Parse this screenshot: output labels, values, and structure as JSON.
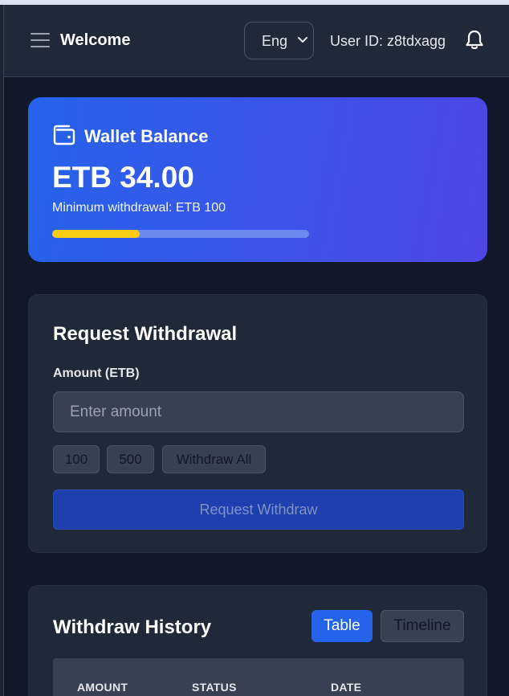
{
  "header": {
    "menu_icon": "hamburger-menu-icon",
    "title": "Welcome",
    "language_selected": "Eng",
    "user_id": "User ID: z8tdxagg",
    "notification_icon": "bell-icon"
  },
  "wallet": {
    "icon": "wallet-icon",
    "title": "Wallet Balance",
    "balance": "ETB 34.00",
    "minimum_text": "Minimum withdrawal: ETB 100",
    "progress_fraction": 0.34,
    "colors": {
      "gradient_start": "#2563eb",
      "gradient_end": "#4f46e5",
      "progress": "#facc15"
    }
  },
  "withdraw_form": {
    "title": "Request Withdrawal",
    "amount_label": "Amount (ETB)",
    "amount_placeholder": "Enter amount",
    "amount_value": "",
    "quick_amounts": [
      "100",
      "500",
      "Withdraw All"
    ],
    "submit_label": "Request Withdraw"
  },
  "history": {
    "title": "Withdraw History",
    "view_table_label": "Table",
    "view_timeline_label": "Timeline",
    "columns": [
      "AMOUNT",
      "STATUS",
      "DATE"
    ]
  }
}
